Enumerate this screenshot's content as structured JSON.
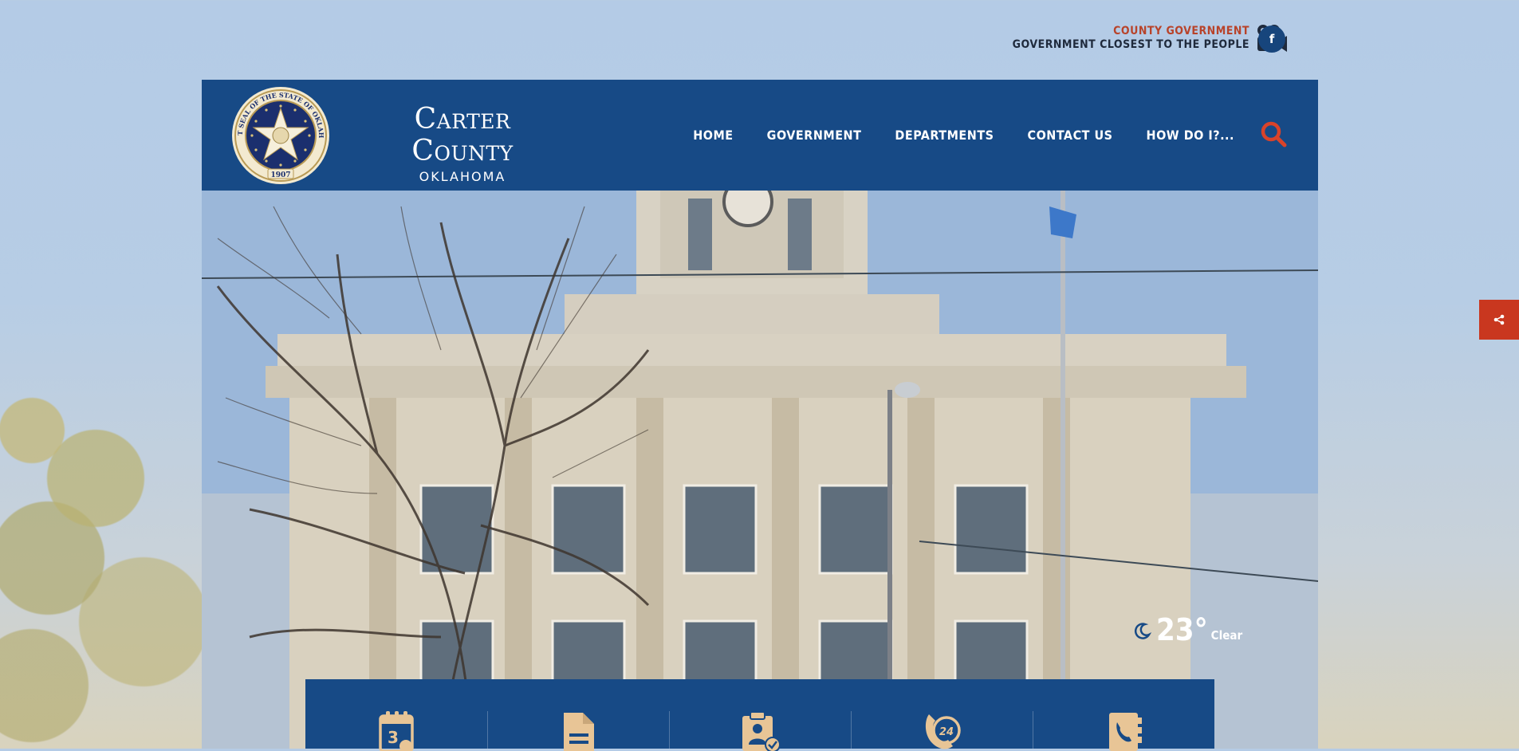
{
  "colors": {
    "primary_blue": "#174a86",
    "accent_red": "#c9371f",
    "tagline_red": "#b8432a",
    "tagline_dark": "#1f2a3c",
    "icon_tan": "#e8c596"
  },
  "topbar": {
    "tagline_1": "COUNTY GOVERNMENT",
    "tagline_2": "GOVERNMENT CLOSEST TO THE PEOPLE",
    "video_icon": "video-camera-icon",
    "facebook_label": "f"
  },
  "header": {
    "seal_alt": "Great Seal of the State of Oklahoma",
    "seal_text": "GREAT SEAL OF THE STATE OF OKLAHOMA",
    "seal_year": "1907",
    "name": "Carter County",
    "state": "OKLAHOMA"
  },
  "nav": {
    "items": [
      {
        "label": "HOME"
      },
      {
        "label": "GOVERNMENT"
      },
      {
        "label": "DEPARTMENTS"
      },
      {
        "label": "CONTACT US"
      },
      {
        "label": "HOW DO I?..."
      }
    ],
    "search_icon": "search-icon"
  },
  "weather": {
    "temp": "23°",
    "condition": "Clear",
    "icon": "moon-icon"
  },
  "share": {
    "icon": "share-icon"
  },
  "quick_links": [
    {
      "icon": "calendar-icon"
    },
    {
      "icon": "document-icon"
    },
    {
      "icon": "job-application-icon"
    },
    {
      "icon": "24-hour-phone-icon"
    },
    {
      "icon": "phone-directory-icon"
    }
  ]
}
